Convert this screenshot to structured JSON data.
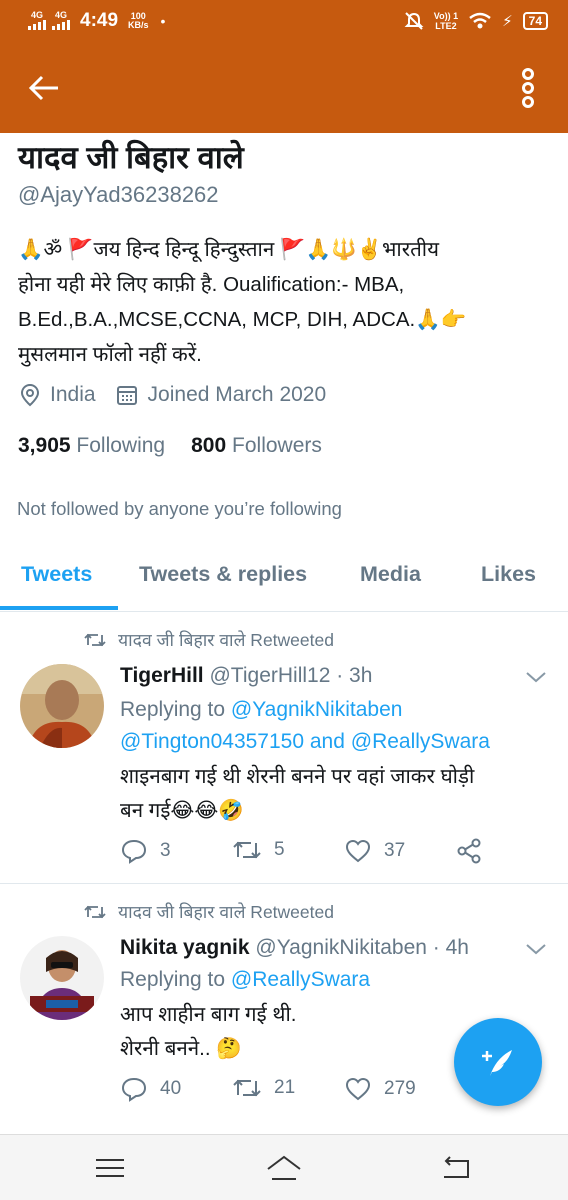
{
  "status_bar": {
    "net1": "4G",
    "net2": "4G",
    "time": "4:49",
    "speed_value": "100",
    "speed_unit": "KB/s",
    "volte": "Vo)) 1",
    "lte": "LTE2",
    "battery": "74"
  },
  "appbar": {
    "back_icon": "arrow-left-icon",
    "more_icon": "more-vertical-icon",
    "color": "#c65a0f"
  },
  "profile": {
    "name": "यादव जी बिहार वाले",
    "handle": "@AjayYad36238262",
    "bio_line1": "🙏ॐ 🚩जय हिन्द हिन्दू हिन्दुस्तान 🚩🙏🔱✌️भारतीय",
    "bio_line2": "होना यही मेरे लिए काफ़ी है. Oualification:- MBA,",
    "bio_line3": "B.Ed.,B.A.,MCSE,CCNA, MCP, DIH, ADCA.🙏👉",
    "bio_line4": "मुसलमान फॉलो नहीं करें.",
    "location": "India",
    "joined": "Joined March 2020",
    "following_count": "3,905",
    "following_label": "Following",
    "followers_count": "800",
    "followers_label": "Followers",
    "not_followed": "Not followed by anyone you’re following"
  },
  "tabs": [
    {
      "label": "Tweets"
    },
    {
      "label": "Tweets & replies"
    },
    {
      "label": "Media"
    },
    {
      "label": "Likes"
    }
  ],
  "tweets": [
    {
      "retweeted_by": "यादव जी बिहार वाले Retweeted",
      "author": "TigerHill",
      "handle_time": "@TigerHill12 · 3h",
      "replying_prefix": "Replying to ",
      "reply_to_1": "@YagnikNikitaben",
      "reply_to_2": "@Tington04357150",
      "reply_and": " and ",
      "reply_to_3": "@ReallySwara",
      "text_line1": "शाइनबाग गई थी शेरनी बनने पर वहां जाकर घोड़ी",
      "text_line2": "बन गई😂😂🤣",
      "replies": "3",
      "retweets": "5",
      "likes": "37"
    },
    {
      "retweeted_by": "यादव जी बिहार वाले Retweeted",
      "author": "Nikita yagnik",
      "handle_time": "@YagnikNikitaben · 4h",
      "replying_prefix": "Replying to ",
      "reply_to_1": "@ReallySwara",
      "text_line1": "आप शाहीन बाग गई थी.",
      "text_line2": "शेरनी बनने.. 🤔",
      "replies": "40",
      "retweets": "21",
      "likes": "279"
    }
  ],
  "colors": {
    "accent": "#1da1f2",
    "header": "#c65a0f",
    "muted": "#657786"
  }
}
